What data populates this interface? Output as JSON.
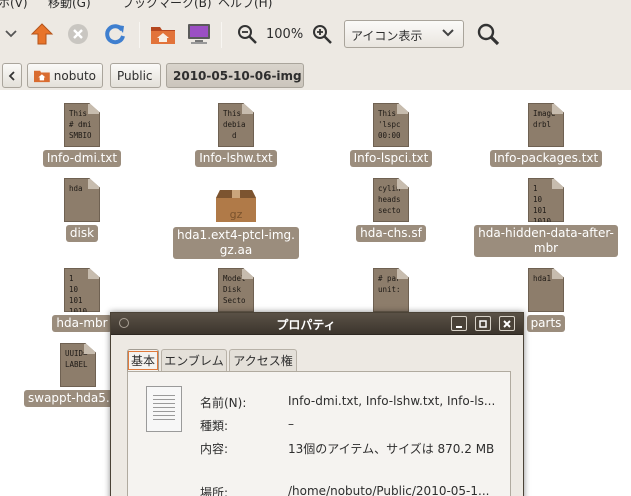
{
  "menubar": {
    "items": [
      "ホ(V)",
      "移動(G)",
      "ブックマーク(B)",
      "ヘルプ(H)"
    ]
  },
  "toolbar": {
    "zoom": "100%",
    "view_mode": "アイコン表示"
  },
  "pathbar": {
    "crumbs": [
      "nobuto",
      "Public",
      "2010-05-10-06-img"
    ]
  },
  "files": [
    {
      "label": "Info-dmi.txt",
      "preview": "This\n# dmi\nSMBIO"
    },
    {
      "label": "Info-lshw.txt",
      "preview": "This\ndebia\n  d"
    },
    {
      "label": "Info-lspci.txt",
      "preview": "This\n'lspc\n00:00"
    },
    {
      "label": "Info-packages.txt",
      "preview": "Image\ndrbl"
    },
    {
      "label": "disk",
      "preview": "hda"
    },
    {
      "label": "hda1.ext4-ptcl-img.\ngz.aa",
      "preview": "gz"
    },
    {
      "label": "hda-chs.sf",
      "preview": "cylin\nheads\nsecto"
    },
    {
      "label": "hda-hidden-data-after-\nmbr",
      "preview": "1\n10\n101\n1010"
    },
    {
      "label": "hda-mbr",
      "preview": "1\n10\n101\n1010"
    },
    {
      "label": "",
      "preview": "Model\nDisk\nSecto"
    },
    {
      "label": "",
      "preview": "# par\nunit:"
    },
    {
      "label": "parts",
      "preview": "hda1"
    },
    {
      "label": "swappt-hda5.",
      "preview": "UUID=\nLABEL"
    }
  ],
  "dialog": {
    "title": "プロパティ",
    "tabs": [
      "基本",
      "エンブレム",
      "アクセス権"
    ],
    "fields": [
      {
        "label": "名前(N):",
        "value": "Info-dmi.txt, Info-lshw.txt, Info-ls..."
      },
      {
        "label": "種類:",
        "value": "–"
      },
      {
        "label": "内容:",
        "value": "13個のアイテム、サイズは 870.2 MB"
      },
      {
        "label": "場所:",
        "value": "/home/nobuto/Public/2010-05-1..."
      }
    ]
  },
  "colors": {
    "selection": "#9b8d7d",
    "chrome": "#ede9e3",
    "titlebar": "#3c352d",
    "accent": "#e07a3c"
  }
}
